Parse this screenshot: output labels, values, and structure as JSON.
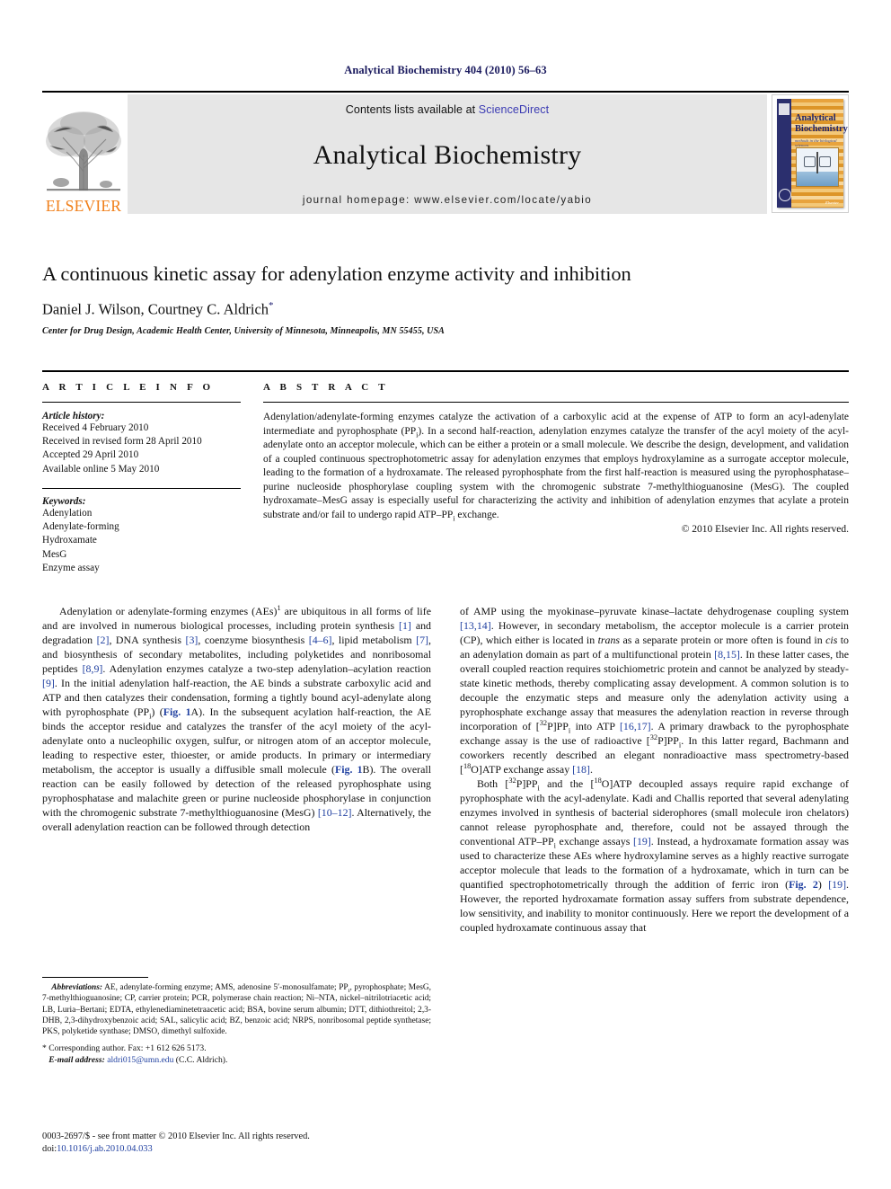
{
  "running_head": "Analytical Biochemistry 404 (2010) 56–63",
  "masthead": {
    "elsevier_wordmark": "ELSEVIER",
    "contents_prefix": "Contents lists available at ",
    "sciencedirect": "ScienceDirect",
    "journal_name": "Analytical Biochemistry",
    "homepage": "journal homepage: www.elsevier.com/locate/yabio",
    "cover": {
      "title_line1": "Analytical",
      "title_line2": "Biochemistry",
      "subtitle": "methods in the biological sciences",
      "brand": "Elsevier"
    }
  },
  "article": {
    "title": "A continuous kinetic assay for adenylation enzyme activity and inhibition",
    "authors": "Daniel J. Wilson, Courtney C. Aldrich",
    "corresponding_marker": "*",
    "affiliation": "Center for Drug Design, Academic Health Center, University of Minnesota, Minneapolis, MN 55455, USA"
  },
  "info": {
    "heading": "A R T I C L E   I N F O",
    "history_label": "Article history:",
    "history": [
      "Received 4 February 2010",
      "Received in revised form 28 April 2010",
      "Accepted 29 April 2010",
      "Available online 5 May 2010"
    ],
    "keywords_label": "Keywords:",
    "keywords": [
      "Adenylation",
      "Adenylate-forming",
      "Hydroxamate",
      "MesG",
      "Enzyme assay"
    ]
  },
  "abstract": {
    "heading": "A B S T R A C T",
    "text": "Adenylation/adenylate-forming enzymes catalyze the activation of a carboxylic acid at the expense of ATP to form an acyl-adenylate intermediate and pyrophosphate (PPi). In a second half-reaction, adenylation enzymes catalyze the transfer of the acyl moiety of the acyl-adenylate onto an acceptor molecule, which can be either a protein or a small molecule. We describe the design, development, and validation of a coupled continuous spectrophotometric assay for adenylation enzymes that employs hydroxylamine as a surrogate acceptor molecule, leading to the formation of a hydroxamate. The released pyrophosphate from the first half-reaction is measured using the pyrophosphatase–purine nucleoside phosphorylase coupling system with the chromogenic substrate 7-methylthioguanosine (MesG). The coupled hydroxamate–MesG assay is especially useful for characterizing the activity and inhibition of adenylation enzymes that acylate a protein substrate and/or fail to undergo rapid ATP–PPi exchange.",
    "copyright": "© 2010 Elsevier Inc. All rights reserved."
  },
  "body": {
    "left_paragraph": "Adenylation or adenylate-forming enzymes (AEs)1 are ubiquitous in all forms of life and are involved in numerous biological processes, including protein synthesis [1] and degradation [2], DNA synthesis [3], coenzyme biosynthesis [4–6], lipid metabolism [7], and biosynthesis of secondary metabolites, including polyketides and nonribosomal peptides [8,9]. Adenylation enzymes catalyze a two-step adenylation–acylation reaction [9]. In the initial adenylation half-reaction, the AE binds a substrate carboxylic acid and ATP and then catalyzes their condensation, forming a tightly bound acyl-adenylate along with pyrophosphate (PPi) (Fig. 1A). In the subsequent acylation half-reaction, the AE binds the acceptor residue and catalyzes the transfer of the acyl moiety of the acyl-adenylate onto a nucleophilic oxygen, sulfur, or nitrogen atom of an acceptor molecule, leading to respective ester, thioester, or amide products. In primary or intermediary metabolism, the acceptor is usually a diffusible small molecule (Fig. 1B). The overall reaction can be easily followed by detection of the released pyrophosphate using pyrophosphatase and malachite green or purine nucleoside phosphorylase in conjunction with the chromogenic substrate 7-methylthioguanosine (MesG) [10–12]. Alternatively, the overall adenylation reaction can be followed through detection",
    "right_paragraph_1": "of AMP using the myokinase–pyruvate kinase–lactate dehydrogenase coupling system [13,14]. However, in secondary metabolism, the acceptor molecule is a carrier protein (CP), which either is located in trans as a separate protein or more often is found in cis to an adenylation domain as part of a multifunctional protein [8,15]. In these latter cases, the overall coupled reaction requires stoichiometric protein and cannot be analyzed by steady-state kinetic methods, thereby complicating assay development. A common solution is to decouple the enzymatic steps and measure only the adenylation activity using a pyrophosphate exchange assay that measures the adenylation reaction in reverse through incorporation of [32P]PPi into ATP [16,17]. A primary drawback to the pyrophosphate exchange assay is the use of radioactive [32P]PPi. In this latter regard, Bachmann and coworkers recently described an elegant nonradioactive mass spectrometry-based [18O]ATP exchange assay [18].",
    "right_paragraph_2": "Both [32P]PPi and the [18O]ATP decoupled assays require rapid exchange of pyrophosphate with the acyl-adenylate. Kadi and Challis reported that several adenylating enzymes involved in synthesis of bacterial siderophores (small molecule iron chelators) cannot release pyrophosphate and, therefore, could not be assayed through the conventional ATP–PPi exchange assays [19]. Instead, a hydroxamate formation assay was used to characterize these AEs where hydroxylamine serves as a highly reactive surrogate acceptor molecule that leads to the formation of a hydroxamate, which in turn can be quantified spectrophotometrically through the addition of ferric iron (Fig. 2) [19]. However, the reported hydroxamate formation assay suffers from substrate dependence, low sensitivity, and inability to monitor continuously. Here we report the development of a coupled hydroxamate continuous assay that"
  },
  "footnotes": {
    "abbreviations_label": "Abbreviations:",
    "abbreviations_text": "AE, adenylate-forming enzyme; AMS, adenosine 5′-monosulfamate; PPi, pyrophosphate; MesG, 7-methylthioguanosine; CP, carrier protein; PCR, polymerase chain reaction; Ni–NTA, nickel–nitrilotriacetic acid; LB, Luria–Bertani; EDTA, ethylenediaminetetraacetic acid; BSA, bovine serum albumin; DTT, dithiothreitol; 2,3-DHB, 2,3-dihydroxybenzoic acid; SAL, salicylic acid; BZ, benzoic acid; NRPS, nonribosomal peptide synthetase; PKS, polyketide synthase; DMSO, dimethyl sulfoxide.",
    "corresponding_marker": "*",
    "corresponding_text": "Corresponding author. Fax: +1 612 626 5173.",
    "email_label": "E-mail address:",
    "email": "aldri015@umn.edu",
    "email_suffix": "(C.C. Aldrich)."
  },
  "footer": {
    "issn_line": "0003-2697/$ - see front matter © 2010 Elsevier Inc. All rights reserved.",
    "doi_label": "doi:",
    "doi": "10.1016/j.ab.2010.04.033"
  }
}
